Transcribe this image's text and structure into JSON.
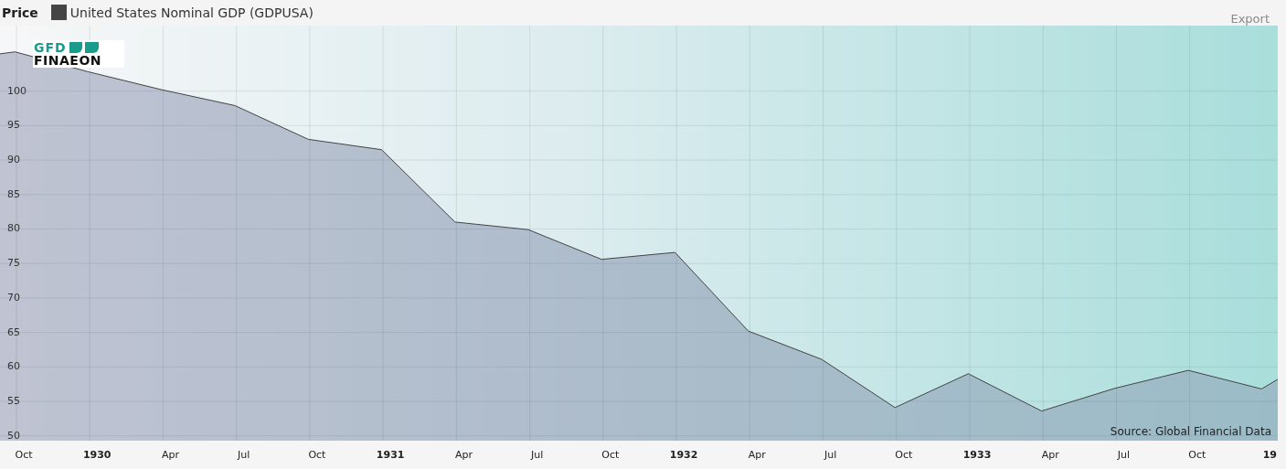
{
  "header": {
    "title": "Price",
    "export": "Export"
  },
  "logo": {
    "top": "GFD",
    "bottom": "FINAEON"
  },
  "chart_data": {
    "type": "area",
    "grid": true,
    "x": [
      1929.669,
      1929.72,
      1929.97,
      1930.22,
      1930.47,
      1930.72,
      1930.97,
      1931.22,
      1931.47,
      1931.72,
      1931.97,
      1932.22,
      1932.47,
      1932.72,
      1932.97,
      1933.22,
      1933.47,
      1933.72,
      1933.97,
      1934.025
    ],
    "series": [
      {
        "name": "United States Nominal GDP (GDPUSA)",
        "color": "#444444",
        "values": [
          105.4,
          105.7,
          102.8,
          100.2,
          97.9,
          93.0,
          91.5,
          81.0,
          79.9,
          75.6,
          76.6,
          65.2,
          61.1,
          54.1,
          59.0,
          53.6,
          56.9,
          59.5,
          56.8,
          58.2
        ]
      }
    ],
    "xlim": [
      1929.669,
      1934.025
    ],
    "ylim": [
      49.3,
      109.5
    ],
    "xticks": [
      {
        "value": 1929.75,
        "label": "Oct"
      },
      1930,
      {
        "value": 1930.25,
        "label": "Apr"
      },
      {
        "value": 1930.5,
        "label": "Jul"
      },
      {
        "value": 1930.75,
        "label": "Oct"
      },
      1931,
      {
        "value": 1931.25,
        "label": "Apr"
      },
      {
        "value": 1931.5,
        "label": "Jul"
      },
      {
        "value": 1931.75,
        "label": "Oct"
      },
      1932,
      {
        "value": 1932.25,
        "label": "Apr"
      },
      {
        "value": 1932.5,
        "label": "Jul"
      },
      {
        "value": 1932.75,
        "label": "Oct"
      },
      1933,
      {
        "value": 1933.25,
        "label": "Apr"
      },
      {
        "value": 1933.5,
        "label": "Jul"
      },
      {
        "value": 1933.75,
        "label": "Oct"
      }
    ],
    "yticks": [
      50,
      55,
      60,
      65,
      70,
      75,
      80,
      85,
      90,
      95,
      100
    ]
  },
  "x_axis_cut_label": "19",
  "source": "Source: Global Financial Data"
}
